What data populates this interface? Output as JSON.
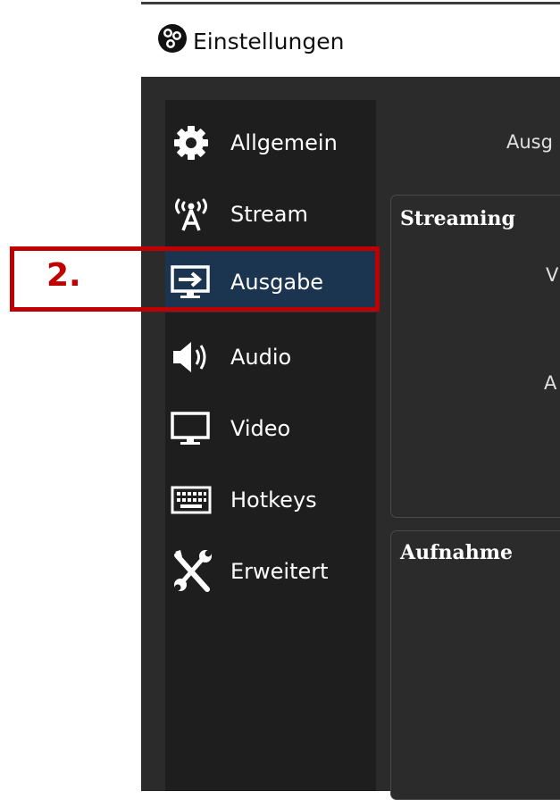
{
  "window": {
    "title": "Einstellungen",
    "logo_icon": "obs-logo-icon"
  },
  "sidebar": {
    "items": [
      {
        "label": "Allgemein",
        "icon": "gear-icon"
      },
      {
        "label": "Stream",
        "icon": "antenna-icon"
      },
      {
        "label": "Ausgabe",
        "icon": "monitor-arrow-icon",
        "selected": true
      },
      {
        "label": "Audio",
        "icon": "speaker-icon"
      },
      {
        "label": "Video",
        "icon": "monitor-icon"
      },
      {
        "label": "Hotkeys",
        "icon": "keyboard-icon"
      },
      {
        "label": "Erweitert",
        "icon": "tools-icon"
      }
    ]
  },
  "main": {
    "mode_label": "Ausg",
    "groups": [
      {
        "title": "Streaming",
        "fields": [
          "V",
          "A"
        ]
      },
      {
        "title": "Aufnahme"
      }
    ]
  },
  "annotation": {
    "step": "2.",
    "color": "#c00000"
  },
  "colors": {
    "selected_bg": "#1b3550",
    "sidebar_bg": "#1e1e1e",
    "panel_bg": "#2b2b2b"
  }
}
